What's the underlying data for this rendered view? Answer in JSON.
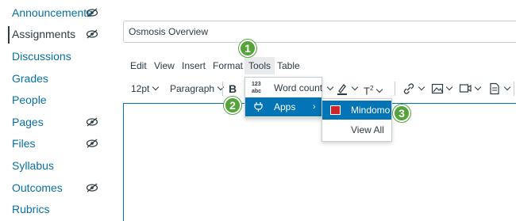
{
  "sidebar": {
    "items": [
      {
        "label": "Announcements",
        "hidden_icon": "eye-slash-icon"
      },
      {
        "label": "Assignments",
        "active": true,
        "hidden_icon": "eye-slash-icon"
      },
      {
        "label": "Discussions"
      },
      {
        "label": "Grades"
      },
      {
        "label": "People"
      },
      {
        "label": "Pages",
        "hidden_icon": "eye-slash-icon"
      },
      {
        "label": "Files",
        "hidden_icon": "eye-slash-icon"
      },
      {
        "label": "Syllabus"
      },
      {
        "label": "Outcomes",
        "hidden_icon": "eye-slash-icon"
      },
      {
        "label": "Rubrics"
      }
    ]
  },
  "title_field": {
    "value": "Osmosis Overview"
  },
  "menubar": {
    "items": [
      "Edit",
      "View",
      "Insert",
      "Format",
      "Tools",
      "Table"
    ]
  },
  "toolbar": {
    "font_size": "12pt",
    "block_format": "Paragraph",
    "superscript_icon": "superscript-icon",
    "highlight_icon": "highlight-color-icon"
  },
  "tools_menu": {
    "word_count": "Word count",
    "apps": "Apps"
  },
  "apps_submenu": {
    "mindomo": "Mindomo",
    "view_all": "View All"
  },
  "callouts": [
    "1",
    "2",
    "3"
  ],
  "colors": {
    "link": "#0770a3",
    "active_text": "#2d3b45",
    "highlight": "#0374b5",
    "callout": "#54a33b",
    "mindomo_icon": "#d0242b"
  }
}
